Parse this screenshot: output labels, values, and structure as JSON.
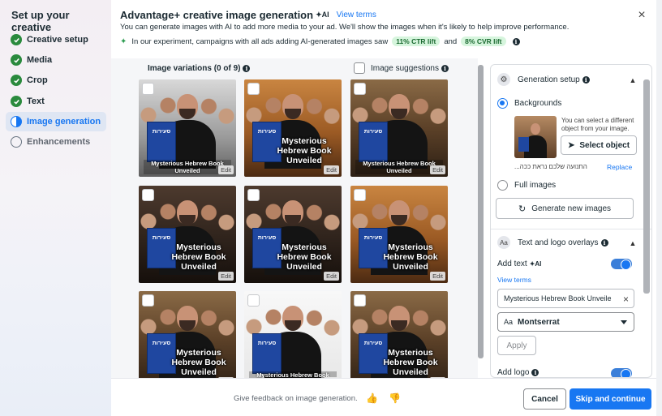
{
  "sidebar": {
    "title": "Set up your creative",
    "steps": [
      {
        "label": "Creative setup",
        "state": "done"
      },
      {
        "label": "Media",
        "state": "done"
      },
      {
        "label": "Crop",
        "state": "done"
      },
      {
        "label": "Text",
        "state": "done"
      },
      {
        "label": "Image generation",
        "state": "active"
      },
      {
        "label": "Enhancements",
        "state": "pending"
      }
    ]
  },
  "header": {
    "title": "Advantage+ creative image generation",
    "ai_badge": "AI",
    "view_terms": "View terms",
    "description": "You can generate images with AI to add more media to your ad. We'll show the images when it's likely to help improve performance.",
    "experiment_text": "In our experiment, campaigns with all ads adding AI-generated images saw",
    "ctr_pill": "11% CTR lift",
    "and_text": "and",
    "cvr_pill": "8% CVR lift"
  },
  "variations": {
    "heading": "Image variations (0 of 9)",
    "suggestions_label": "Image suggestions",
    "edit_label": "Edit",
    "book_title": "סעירות",
    "overlay_text": "Mysterious Hebrew Book Unveiled",
    "overlay_small_text": "Mysterious Hebrew Book Unveiled",
    "tiles": [
      {
        "style": "small"
      },
      {
        "style": "big"
      },
      {
        "style": "small"
      },
      {
        "style": "big"
      },
      {
        "style": "big"
      },
      {
        "style": "big"
      },
      {
        "style": "big"
      },
      {
        "style": "small"
      },
      {
        "style": "big"
      }
    ]
  },
  "config": {
    "generation_setup": "Generation setup",
    "backgrounds": "Backgrounds",
    "bg_hint": "You can select a different object from your image.",
    "select_object": "Select object",
    "hebrew_caption": "...התנועה שלכם נראת ככה",
    "replace": "Replace",
    "full_images": "Full images",
    "generate_new": "Generate new images",
    "text_logo": "Text and logo overlays",
    "add_text": "Add text",
    "ai_badge": "AI",
    "view_terms": "View terms",
    "text_value": "Mysterious Hebrew Book Unveile",
    "font_aa": "Aa",
    "font_value": "Montserrat",
    "apply": "Apply",
    "add_logo": "Add logo"
  },
  "footer": {
    "feedback": "Give feedback on image generation.",
    "cancel": "Cancel",
    "skip": "Skip and continue"
  },
  "colors": {
    "accent": "#1877f2",
    "success": "#2a8a3d",
    "pill_bg": "#d6f5dd"
  }
}
